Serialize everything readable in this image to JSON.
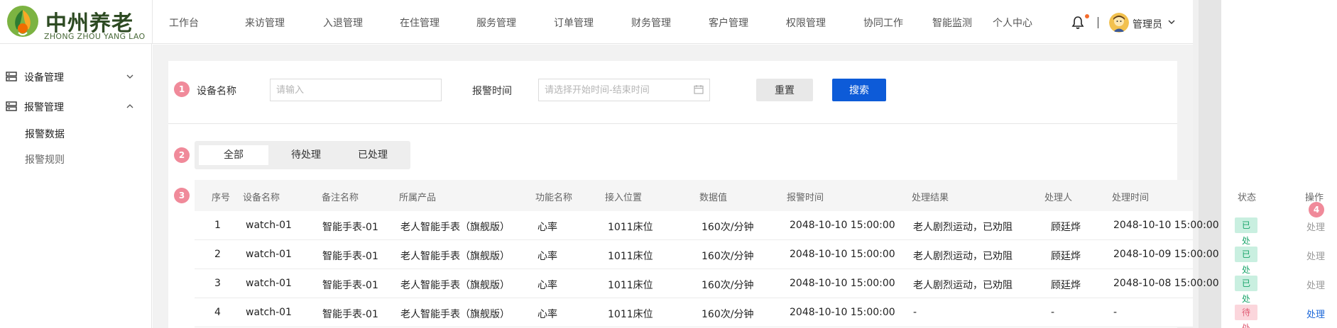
{
  "logo": {
    "title": "中州养老",
    "subtitle": "ZHONG ZHOU YANG LAO"
  },
  "nav": [
    "工作台",
    "来访管理",
    "入退管理",
    "在住管理",
    "服务管理",
    "订单管理",
    "财务管理",
    "客户管理",
    "权限管理",
    "协同工作",
    "智能监测",
    "个人中心"
  ],
  "user": {
    "name": "管理员"
  },
  "sidebar": {
    "groups": [
      {
        "label": "设备管理",
        "expanded": false
      },
      {
        "label": "报警管理",
        "expanded": true
      }
    ],
    "sub_items": [
      {
        "label": "报警数据",
        "active": true
      },
      {
        "label": "报警规则",
        "active": false
      }
    ]
  },
  "markers": [
    "1",
    "2",
    "3",
    "4"
  ],
  "filters": {
    "device_label": "设备名称",
    "device_placeholder": "请输入",
    "time_label": "报警时间",
    "time_placeholder": "请选择开始时间-结束时间",
    "reset_label": "重置",
    "search_label": "搜索"
  },
  "tabs": [
    {
      "label": "全部",
      "active": true
    },
    {
      "label": "待处理",
      "active": false
    },
    {
      "label": "已处理",
      "active": false
    }
  ],
  "table": {
    "columns": [
      "序号",
      "设备名称",
      "备注名称",
      "所属产品",
      "功能名称",
      "接入位置",
      "数据值",
      "报警时间",
      "处理结果",
      "处理人",
      "处理时间",
      "状态",
      "操作"
    ],
    "rows": [
      {
        "no": "1",
        "device": "watch-01",
        "remark": "智能手表-01",
        "product": "老人智能手表（旗舰版）",
        "func": "心率",
        "location": "1011床位",
        "value": "160次/分钟",
        "alarm_time": "2048-10-10 15:00:00",
        "result": "老人剧烈运动，已劝阻",
        "handler": "顾廷烨",
        "handle_time": "2048-10-10 15:00:00",
        "status": "已处理",
        "status_type": "done",
        "op": "处理"
      },
      {
        "no": "2",
        "device": "watch-01",
        "remark": "智能手表-01",
        "product": "老人智能手表（旗舰版）",
        "func": "心率",
        "location": "1011床位",
        "value": "160次/分钟",
        "alarm_time": "2048-10-10 15:00:00",
        "result": "老人剧烈运动，已劝阻",
        "handler": "顾廷烨",
        "handle_time": "2048-10-09 15:00:00",
        "status": "已处理",
        "status_type": "done",
        "op": "处理"
      },
      {
        "no": "3",
        "device": "watch-01",
        "remark": "智能手表-01",
        "product": "老人智能手表（旗舰版）",
        "func": "心率",
        "location": "1011床位",
        "value": "160次/分钟",
        "alarm_time": "2048-10-10 15:00:00",
        "result": "老人剧烈运动，已劝阻",
        "handler": "顾廷烨",
        "handle_time": "2048-10-08 15:00:00",
        "status": "已处理",
        "status_type": "done",
        "op": "处理"
      },
      {
        "no": "4",
        "device": "watch-01",
        "remark": "智能手表-01",
        "product": "老人智能手表（旗舰版）",
        "func": "心率",
        "location": "1011床位",
        "value": "160次/分钟",
        "alarm_time": "2048-10-10 15:00:00",
        "result": "-",
        "handler": "-",
        "handle_time": "-",
        "status": "待处理",
        "status_type": "pending",
        "op": "处理"
      }
    ]
  }
}
